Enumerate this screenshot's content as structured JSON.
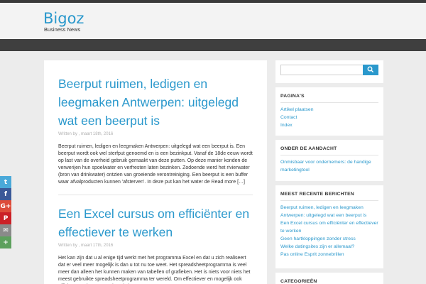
{
  "site": {
    "title": "Bigoz",
    "description": "Business News"
  },
  "posts": [
    {
      "title": "Beerput ruimen, ledigen en leegmaken Antwerpen: uitgelegd wat een beerput is",
      "meta": "Written by , maart 18th, 2016",
      "excerpt": "Beerput ruimen, ledigen en leegmaken Antwerpen: uitgelegd wat een beerput is. Een beerput wordt ook wel sterfput genoemd en is een bezinkput. Vanaf de 18de eeuw wordt op last van de overheid gebruik gemaakt van deze putten. Op deze manier konden de verwerijen hun spoelwater en verfresten laten bezinken. Zodoende werd het rivierwater (bron van drinkwater) ontzien van groeiende verontreiniging. Een beerput is een buffer waar afvalproducten kunnen 'afsterven'. In deze put kan het water de Read more […]"
    },
    {
      "title": "Een Excel cursus om efficiënter en effectiever te werken",
      "meta": "Written by , maart 17th, 2016",
      "excerpt": "Het kan zijn dat u al enige tijd werkt met het programma Excel en dat u zich realiseert dat er veel meer mogelijk is dan u tot nu toe weet. Het spreadsheetprogramma is veel meer dan alleen het kunnen maken van tabellen of grafieken. Het is niets voor niets het meest gebruikte spreadsheetprogramma ter wereld. Om effectiever en mogelijk ook efficiënter te kunnen werken, is het van"
    }
  ],
  "sidebar": {
    "search_placeholder": "",
    "widgets": [
      {
        "title": "PAGINA'S",
        "items": [
          "Artikel plaatsen",
          "Contact",
          "Index"
        ]
      },
      {
        "title": "ONDER DE AANDACHT",
        "items": [
          "Onmisbaar voor ondernemers: de handige marketingtool"
        ]
      },
      {
        "title": "MEEST RECENTE BERICHTEN",
        "items": [
          "Beerput ruimen, ledigen en leegmaken Antwerpen: uitgelegd wat een beerput is",
          "Een Excel cursus om efficiënter en effectiever te werken",
          "Geen hartkloppingen zonder stress",
          "Welke datingsites zijn er allemaal?",
          "Pas online Esprit zonnebrillen"
        ]
      },
      {
        "title": "CATEGORIEËN",
        "items": []
      }
    ]
  },
  "social": [
    {
      "name": "twitter-icon",
      "glyph": "t",
      "color": "#4aa9d9"
    },
    {
      "name": "facebook-icon",
      "glyph": "f",
      "color": "#3b5998"
    },
    {
      "name": "googleplus-icon",
      "glyph": "G+",
      "color": "#dd4b39"
    },
    {
      "name": "pinterest-icon",
      "glyph": "P",
      "color": "#cb2027"
    },
    {
      "name": "email-icon",
      "glyph": "✉",
      "color": "#8a8a8a"
    },
    {
      "name": "share-icon",
      "glyph": "+",
      "color": "#5da05d"
    }
  ],
  "colors": {
    "accent": "#2a98cc",
    "nav": "#3f3f3f"
  }
}
